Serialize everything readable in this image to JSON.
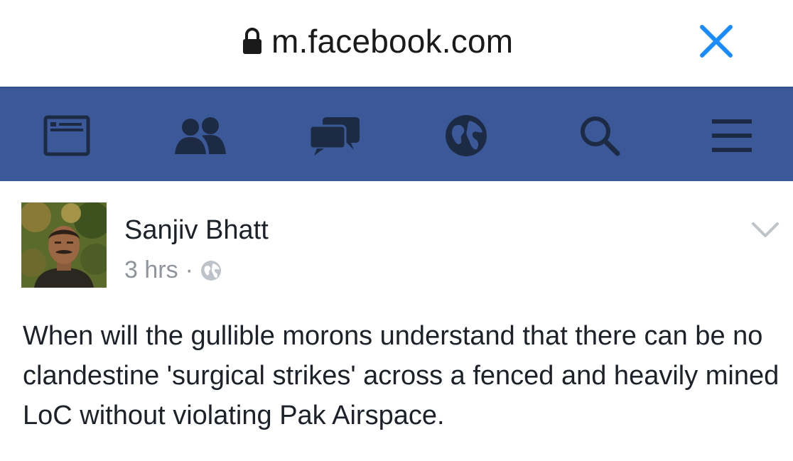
{
  "browser": {
    "url": "m.facebook.com",
    "icons": {
      "lock": "lock-icon",
      "close": "close-icon"
    },
    "accent_color": "#1a8cff"
  },
  "navbar": {
    "background_color": "#3b5998",
    "icon_color": "#1d2a44",
    "items": [
      {
        "icon": "news-feed-icon"
      },
      {
        "icon": "friends-icon"
      },
      {
        "icon": "messages-icon"
      },
      {
        "icon": "globe-icon"
      },
      {
        "icon": "search-icon"
      },
      {
        "icon": "menu-icon"
      }
    ]
  },
  "post": {
    "author": "Sanjiv Bhatt",
    "time": "3 hrs",
    "separator": "·",
    "privacy_icon": "globe-icon",
    "options_icon": "chevron-down-icon",
    "text": "When will the gullible morons understand that there can be no clandestine 'surgical strikes' across a fenced and heavily mined LoC without violating Pak Airspace."
  }
}
